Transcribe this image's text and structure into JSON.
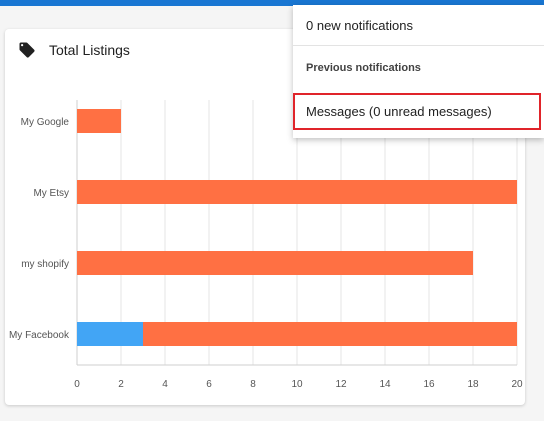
{
  "card": {
    "title": "Total Listings",
    "icon": "tag-icon"
  },
  "notifications": {
    "new_label": "0 new notifications",
    "previous_label": "Previous notifications",
    "messages_label": "Messages (0 unread messages)"
  },
  "colors": {
    "accent": "#1976d2",
    "bar_orange": "#ff7043",
    "bar_blue": "#42a5f5",
    "highlight_border": "#e0242a"
  },
  "chart_data": {
    "type": "bar",
    "orientation": "horizontal",
    "stacked": true,
    "title": "Total Listings",
    "categories": [
      "My Google",
      "My Etsy",
      "my shopify",
      "My Facebook"
    ],
    "series": [
      {
        "color": "#42a5f5",
        "values": [
          0,
          0,
          0,
          3
        ]
      },
      {
        "color": "#ff7043",
        "values": [
          2,
          20,
          18,
          17
        ]
      }
    ],
    "xlim": [
      0,
      20
    ],
    "xticks": [
      0,
      2,
      4,
      6,
      8,
      10,
      12,
      14,
      16,
      18,
      20
    ],
    "grid": true
  }
}
